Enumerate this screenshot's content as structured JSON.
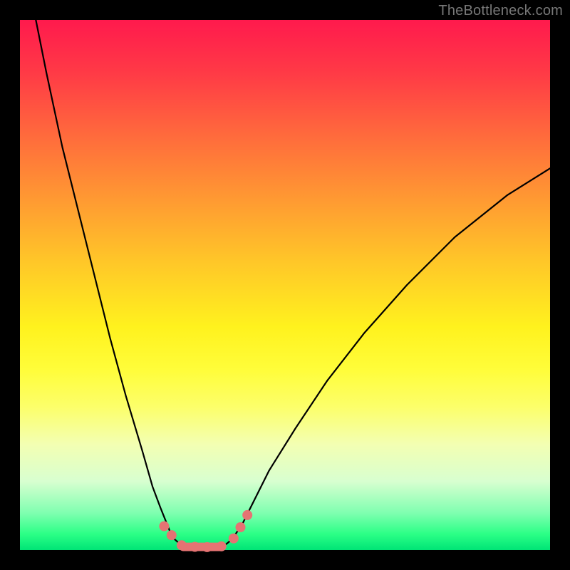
{
  "watermark": "TheBottleneck.com",
  "colors": {
    "frame_bg_top": "#ff1a4d",
    "frame_bg_bottom": "#00e476",
    "curve": "#000000",
    "marker": "#e57373",
    "page_bg": "#000000",
    "watermark": "#777777"
  },
  "chart_data": {
    "type": "line",
    "title": "",
    "xlabel": "",
    "ylabel": "",
    "xlim": [
      0,
      100
    ],
    "ylim": [
      0,
      100
    ],
    "grid": false,
    "legend": false,
    "series": [
      {
        "name": "left-branch",
        "x": [
          3,
          5,
          8,
          11,
          14,
          17,
          20,
          23,
          25,
          26.5,
          27.5,
          28.3,
          29,
          30,
          31
        ],
        "y": [
          100,
          90,
          76,
          64,
          52,
          40,
          29,
          19,
          12,
          8,
          5.5,
          3.5,
          2.2,
          1.3,
          0.8
        ]
      },
      {
        "name": "floor",
        "x": [
          31,
          33,
          35,
          37,
          38.5
        ],
        "y": [
          0.8,
          0.6,
          0.55,
          0.6,
          0.8
        ]
      },
      {
        "name": "right-branch",
        "x": [
          38.5,
          40,
          42,
          44,
          47,
          52,
          58,
          65,
          73,
          82,
          92,
          100
        ],
        "y": [
          0.8,
          2,
          5,
          9,
          15,
          23,
          32,
          41,
          50,
          59,
          67,
          72
        ]
      }
    ],
    "markers": [
      {
        "x": 27.2,
        "y": 4.5
      },
      {
        "x": 28.6,
        "y": 2.8
      },
      {
        "x": 30.5,
        "y": 0.9
      },
      {
        "x": 33.0,
        "y": 0.6
      },
      {
        "x": 35.3,
        "y": 0.55
      },
      {
        "x": 38.0,
        "y": 0.7
      },
      {
        "x": 40.3,
        "y": 2.2
      },
      {
        "x": 41.6,
        "y": 4.3
      },
      {
        "x": 42.9,
        "y": 6.6
      }
    ],
    "floor_bar": {
      "x0": 30.0,
      "x1": 38.8,
      "y": 0.6,
      "thickness_pct": 1.6
    }
  }
}
